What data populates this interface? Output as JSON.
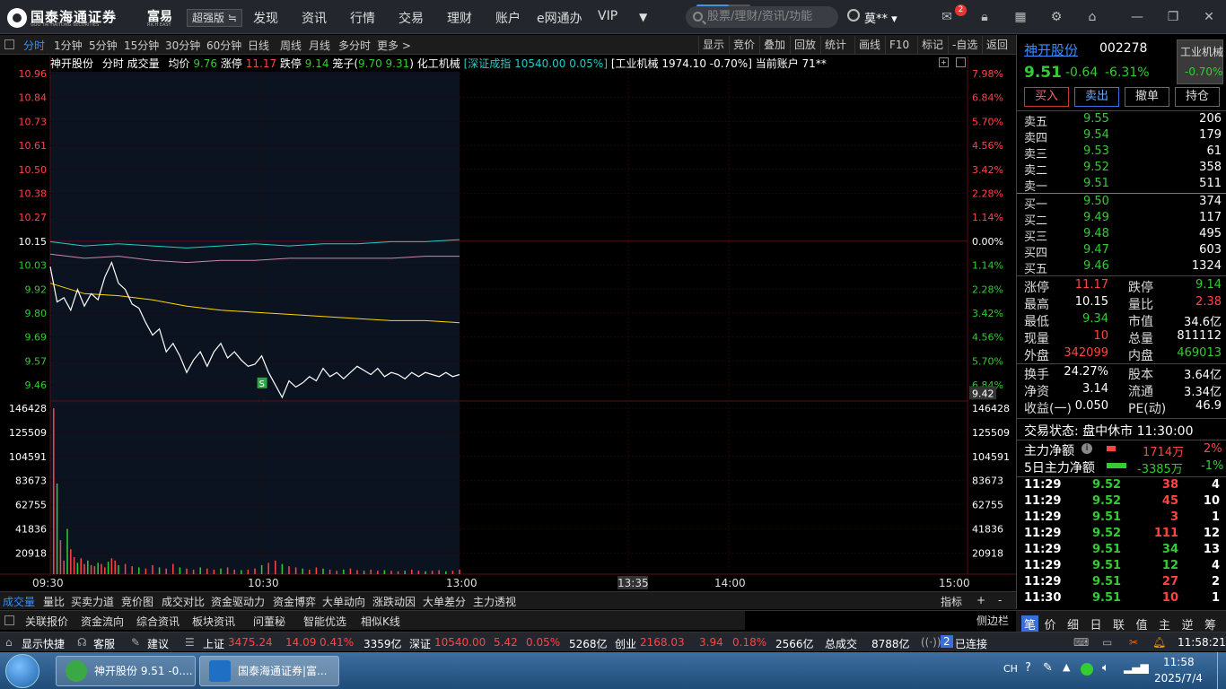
{
  "app": {
    "logo_text": "国泰海通证券",
    "logo_subtext": "GUO TAI HAITONG SECURITIES",
    "brand": "富易",
    "brand_sub": "RICH EASY",
    "edition": "超强版 ≒",
    "nav": [
      "发现",
      "资讯",
      "行情",
      "交易",
      "理财",
      "账户",
      "e网通办",
      "VIP"
    ],
    "nav_more": "▼",
    "search_placeholder": "股票/理财/资讯/功能",
    "user": "莫**",
    "mail_badge": "2",
    "search_progress": 0.6
  },
  "toolbar": {
    "periods": [
      "分时",
      "1分钟",
      "5分钟",
      "15分钟",
      "30分钟",
      "60分钟",
      "日线",
      "周线",
      "月线",
      "多分时",
      "更多 >"
    ],
    "active": "分时",
    "right": [
      "显示",
      "竞价",
      "叠加",
      "回放",
      "统计",
      "画线",
      "F10",
      "标记",
      "-自选",
      "返回"
    ]
  },
  "infobar": {
    "name": "神开股份",
    "mode": "分时 成交量",
    "avg_label": "均价",
    "avg_value": "9.76",
    "limit_up_label": "涨停",
    "limit_up": "11.17",
    "limit_down_label": "跌停",
    "limit_down": "9.14",
    "cage_label": "笼子(",
    "cage_values": "9.70 9.31",
    "cage_close": ")",
    "industry": "化工机械",
    "index_text": "[深证成指 10540.00 0.05%]",
    "sector_text": "[工业机械 1974.10 -0.70%]",
    "account": "当前账户 71**"
  },
  "chart_data": {
    "type": "line",
    "title": "",
    "price_axis": {
      "ticks": [
        "10.96",
        "10.84",
        "10.73",
        "10.61",
        "10.50",
        "10.38",
        "10.27",
        "10.15",
        "10.03",
        "9.92",
        "9.80",
        "9.69",
        "9.57",
        "9.46"
      ],
      "pct_ticks": [
        "7.98%",
        "6.84%",
        "5.70%",
        "4.56%",
        "3.42%",
        "2.28%",
        "1.14%",
        "0.00%",
        "1.14%",
        "2.28%",
        "3.42%",
        "4.56%",
        "5.70%",
        "6.84%"
      ],
      "prev_close": 10.15,
      "ylim": [
        9.34,
        10.96
      ],
      "last_label": "9.42"
    },
    "volume_axis": {
      "ticks": [
        "146428",
        "125509",
        "104591",
        "83673",
        "62755",
        "41836",
        "20918"
      ],
      "ylim": [
        0,
        146428
      ]
    },
    "time_labels": [
      "09:30",
      "10:30",
      "13:00",
      "13:35",
      "14:00",
      "15:00"
    ],
    "price_series": {
      "name": "价格",
      "x_minutes": [
        0,
        2,
        4,
        6,
        8,
        10,
        12,
        14,
        16,
        18,
        20,
        22,
        24,
        26,
        28,
        30,
        32,
        34,
        36,
        38,
        40,
        42,
        44,
        46,
        48,
        50,
        52,
        54,
        56,
        58,
        60,
        62,
        64,
        66,
        68,
        70,
        72,
        74,
        76,
        78,
        80,
        82,
        84,
        86,
        88,
        90,
        92,
        94,
        96,
        98,
        100,
        102,
        104,
        106,
        108,
        110,
        112,
        114,
        116,
        118,
        120
      ],
      "y": [
        10.03,
        9.86,
        9.88,
        9.82,
        9.92,
        9.84,
        9.9,
        9.87,
        9.98,
        10.05,
        9.95,
        9.92,
        9.85,
        9.83,
        9.76,
        9.7,
        9.73,
        9.62,
        9.66,
        9.6,
        9.52,
        9.58,
        9.62,
        9.55,
        9.62,
        9.66,
        9.59,
        9.62,
        9.58,
        9.55,
        9.56,
        9.6,
        9.52,
        9.46,
        9.4,
        9.48,
        9.45,
        9.47,
        9.5,
        9.48,
        9.54,
        9.5,
        9.52,
        9.49,
        9.52,
        9.55,
        9.53,
        9.51,
        9.54,
        9.5,
        9.52,
        9.51,
        9.49,
        9.52,
        9.5,
        9.52,
        9.51,
        9.5,
        9.52,
        9.5,
        9.51
      ]
    },
    "avg_series": {
      "name": "均价",
      "x_minutes": [
        0,
        10,
        20,
        30,
        40,
        50,
        60,
        70,
        80,
        90,
        100,
        110,
        120
      ],
      "y": [
        9.95,
        9.9,
        9.89,
        9.87,
        9.84,
        9.82,
        9.81,
        9.8,
        9.79,
        9.78,
        9.77,
        9.77,
        9.76
      ]
    },
    "index_series": {
      "name": "深证成指",
      "x_minutes": [
        0,
        10,
        20,
        30,
        40,
        50,
        60,
        70,
        80,
        90,
        100,
        110,
        120
      ],
      "y": [
        10.15,
        10.13,
        10.14,
        10.13,
        10.12,
        10.13,
        10.14,
        10.13,
        10.14,
        10.14,
        10.15,
        10.15,
        10.16
      ]
    },
    "sector_series": {
      "name": "工业机械",
      "x_minutes": [
        0,
        10,
        20,
        30,
        40,
        50,
        60,
        70,
        80,
        90,
        100,
        110,
        120
      ],
      "y": [
        10.09,
        10.07,
        10.08,
        10.06,
        10.05,
        10.06,
        10.06,
        10.07,
        10.07,
        10.07,
        10.07,
        10.08,
        10.08
      ]
    },
    "marker": {
      "label": "S",
      "x_minute": 62,
      "price": 9.47
    },
    "volume": {
      "x_minutes": [
        1,
        2,
        3,
        4,
        5,
        6,
        7,
        8,
        9,
        10,
        11,
        12,
        13,
        14,
        15,
        16,
        17,
        18,
        19,
        20,
        22,
        24,
        26,
        28,
        30,
        32,
        34,
        36,
        38,
        40,
        42,
        44,
        46,
        48,
        50,
        52,
        54,
        56,
        58,
        60,
        62,
        64,
        66,
        68,
        70,
        72,
        74,
        76,
        78,
        80,
        82,
        84,
        86,
        88,
        90,
        92,
        94,
        96,
        98,
        100,
        102,
        104,
        106,
        108,
        110,
        112,
        114,
        116,
        118,
        120
      ],
      "values": [
        146428,
        80000,
        30000,
        12000,
        40000,
        22000,
        15000,
        10000,
        14000,
        9000,
        12000,
        8000,
        7000,
        10000,
        9000,
        6000,
        11000,
        14000,
        12000,
        8000,
        9000,
        7000,
        6000,
        5000,
        8000,
        6000,
        5000,
        9000,
        6000,
        5000,
        4000,
        6000,
        5000,
        4000,
        5000,
        6000,
        4000,
        3500,
        4000,
        5000,
        8000,
        10000,
        12000,
        9000,
        7000,
        6000,
        5000,
        4000,
        6000,
        5000,
        4000,
        3000,
        4000,
        5000,
        3500,
        3000,
        4000,
        3000,
        3500,
        3000,
        2500,
        3000,
        4000,
        3000,
        2500,
        3000,
        3500,
        2500,
        3000,
        4000
      ]
    }
  },
  "right_panel": {
    "name": "神开股份",
    "code": "002278",
    "sector": "工业机械",
    "sector_pct": "-0.70%",
    "price": "9.51",
    "change": "-0.64",
    "change_pct": "-6.31%",
    "buttons": [
      "买入",
      "卖出",
      "撤单",
      "持仓"
    ],
    "asks": [
      {
        "label": "卖五",
        "price": "9.55",
        "vol": "206"
      },
      {
        "label": "卖四",
        "price": "9.54",
        "vol": "179"
      },
      {
        "label": "卖三",
        "price": "9.53",
        "vol": "61"
      },
      {
        "label": "卖二",
        "price": "9.52",
        "vol": "358"
      },
      {
        "label": "卖一",
        "price": "9.51",
        "vol": "511"
      }
    ],
    "bids": [
      {
        "label": "买一",
        "price": "9.50",
        "vol": "374"
      },
      {
        "label": "买二",
        "price": "9.49",
        "vol": "117"
      },
      {
        "label": "买三",
        "price": "9.48",
        "vol": "495"
      },
      {
        "label": "买四",
        "price": "9.47",
        "vol": "603"
      },
      {
        "label": "买五",
        "price": "9.46",
        "vol": "1324"
      }
    ],
    "stats": [
      {
        "l1": "涨停",
        "v1": "11.17",
        "c1": "red",
        "l2": "跌停",
        "v2": "9.14",
        "c2": "green"
      },
      {
        "l1": "最高",
        "v1": "10.15",
        "c1": "white",
        "l2": "量比",
        "v2": "2.38",
        "c2": "red"
      },
      {
        "l1": "最低",
        "v1": "9.34",
        "c1": "green",
        "l2": "市值",
        "v2": "34.6亿",
        "c2": "white"
      },
      {
        "l1": "现量",
        "v1": "10",
        "c1": "red",
        "l2": "总量",
        "v2": "811112",
        "c2": "white"
      },
      {
        "l1": "外盘",
        "v1": "342099",
        "c1": "red",
        "l2": "内盘",
        "v2": "469013",
        "c2": "green"
      }
    ],
    "stats2": [
      {
        "l1": "换手",
        "v1": "24.27%",
        "c1": "white",
        "l2": "股本",
        "v2": "3.64亿",
        "c2": "white"
      },
      {
        "l1": "净资",
        "v1": "3.14",
        "c1": "white",
        "l2": "流通",
        "v2": "3.34亿",
        "c2": "white"
      },
      {
        "l1": "收益(一)",
        "v1": "0.050",
        "c1": "white",
        "l2": "PE(动)",
        "v2": "46.9",
        "c2": "white"
      }
    ],
    "trade_status": "交易状态: 盘中休市 11:30:00",
    "main_net_label": "主力净额",
    "main_net": "1714万",
    "main_net_pct": "2%",
    "five_day_label": "5日主力净额",
    "five_day": "-3385万",
    "five_day_pct": "-1%",
    "ticks": [
      {
        "t": "11:29",
        "p": "9.52",
        "v": "38",
        "c": "red",
        "n": "4"
      },
      {
        "t": "11:29",
        "p": "9.52",
        "v": "45",
        "c": "red",
        "n": "10"
      },
      {
        "t": "11:29",
        "p": "9.51",
        "v": "3",
        "c": "red",
        "n": "1"
      },
      {
        "t": "11:29",
        "p": "9.52",
        "v": "111",
        "c": "red",
        "n": "12"
      },
      {
        "t": "11:29",
        "p": "9.51",
        "v": "34",
        "c": "green",
        "n": "13"
      },
      {
        "t": "11:29",
        "p": "9.51",
        "v": "12",
        "c": "green",
        "n": "4"
      },
      {
        "t": "11:29",
        "p": "9.51",
        "v": "27",
        "c": "red",
        "n": "2"
      },
      {
        "t": "11:30",
        "p": "9.51",
        "v": "10",
        "c": "red",
        "n": "1"
      }
    ],
    "bottom_tabs": [
      "笔",
      "价",
      "细",
      "日",
      "联",
      "值",
      "主",
      "逆",
      "筹"
    ],
    "side_label": "侧边栏"
  },
  "bottom_tabs": {
    "items": [
      "成交量",
      "量比",
      "买卖力道",
      "竞价图",
      "成交对比",
      "资金驱动力",
      "资金博弈",
      "大单动向",
      "涨跌动因",
      "大单差分",
      "主力透视"
    ],
    "right": [
      "指标",
      "+",
      "-"
    ]
  },
  "subbar": {
    "items": [
      "关联报价",
      "资金流向",
      "综合资讯",
      "板块资讯",
      "问董秘",
      "智能优选",
      "相似K线"
    ]
  },
  "statusbar": {
    "show_shortcut": "显示快捷",
    "service": "客服",
    "suggest": "建议",
    "sh_label": "上证",
    "sh_value": "3475.24",
    "sh_change": "14.09",
    "sh_pct": "0.41%",
    "sh_amount": "3359亿",
    "sz_label": "深证",
    "sz_value": "10540.00",
    "sz_change": "5.42",
    "sz_pct": "0.05%",
    "sz_amount": "5268亿",
    "cy_label": "创业",
    "cy_value": "2168.03",
    "cy_change": "3.94",
    "cy_pct": "0.18%",
    "cy_amount": "2566亿",
    "total_label": "总成交",
    "total_amount": "8788亿",
    "conn_count": "2",
    "connected": "已连接",
    "time": "11:58:21"
  },
  "taskbar": {
    "tasks": [
      "神开股份 9.51 -0....",
      "国泰海通证券|富..."
    ],
    "lang": "CH",
    "time": "11:58",
    "date": "2025/7/4"
  }
}
